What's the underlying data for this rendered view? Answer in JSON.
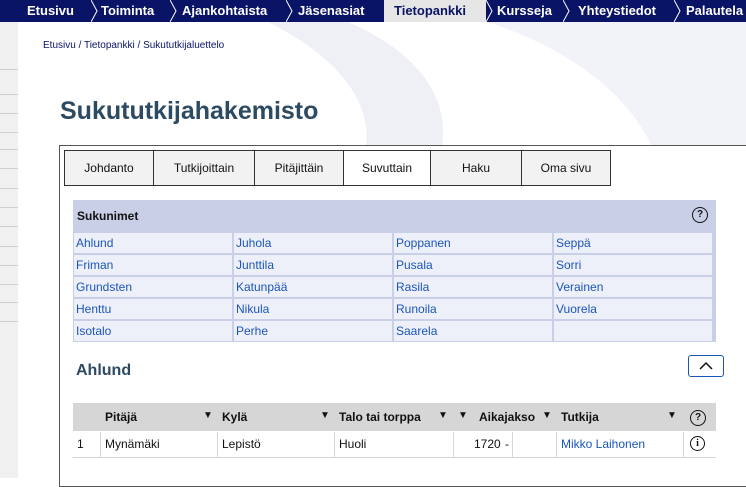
{
  "topnav": {
    "items": [
      {
        "label": "Etusivu"
      },
      {
        "label": "Toiminta"
      },
      {
        "label": "Ajankohtaista"
      },
      {
        "label": "Jäsenasiat"
      },
      {
        "label": "Tietopankki"
      },
      {
        "label": "Kursseja"
      },
      {
        "label": "Yhteystiedot"
      },
      {
        "label": "Palautela"
      }
    ],
    "active_index": 4
  },
  "breadcrumb": {
    "items": [
      "Etusivu",
      "Tietopankki",
      "Sukututkijaluettelo"
    ],
    "separator": " / "
  },
  "page_title": "Sukututkijahakemisto",
  "tabs": [
    {
      "label": "Johdanto"
    },
    {
      "label": "Tutkijoittain"
    },
    {
      "label": "Pitäjittäin"
    },
    {
      "label": "Suvuttain",
      "active": true
    },
    {
      "label": "Haku"
    },
    {
      "label": "Oma sivu"
    }
  ],
  "surnames": {
    "header": "Sukunimet",
    "help": "?",
    "columns": [
      [
        "Ahlund",
        "Friman",
        "Grundsten",
        "Henttu",
        "Isotalo"
      ],
      [
        "Juhola",
        "Junttila",
        "Katunpää",
        "Nikula",
        "Perhe"
      ],
      [
        "Poppanen",
        "Pusala",
        "Rasila",
        "Runoila",
        "Saarela"
      ],
      [
        "Seppä",
        "Sorri",
        "Verainen",
        "Vuorela",
        ""
      ]
    ]
  },
  "selected": {
    "title": "Ahlund"
  },
  "table": {
    "headers": [
      "Pitäjä",
      "Kylä",
      "Talo tai torppa",
      "Aikajakso",
      "Tutkija"
    ],
    "help": "?",
    "rows": [
      {
        "num": "1",
        "pitaja": "Mynämäki",
        "kyla": "Lepistö",
        "talo": "Huoli",
        "alku": "1720",
        "viiva": "-",
        "loppu": "",
        "tutkija": "Mikko Laihonen",
        "info": "i"
      }
    ]
  },
  "colors": {
    "nav_bg": "#0a1466",
    "link": "#1a55b8",
    "title": "#2d4a63",
    "surname_bg": "#c8cfe6"
  }
}
